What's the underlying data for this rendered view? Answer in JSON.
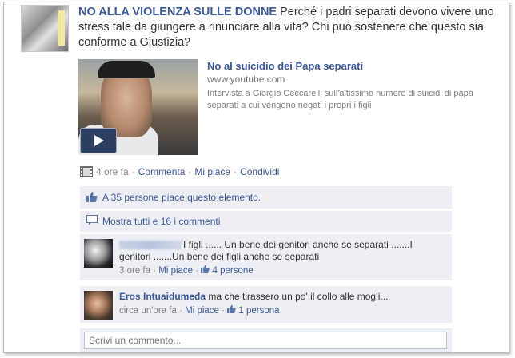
{
  "post": {
    "author": "NO ALLA VIOLENZA SULLE DONNE",
    "text": "Perché i padri separati devono vivere uno stress tale da giungere a rinunciare alla vita? Chi può sostenere che questo sia conforme a Giustizia?"
  },
  "link": {
    "title": "No al suicidio dei Papa separati",
    "url": "www.youtube.com",
    "description": "Intervista a Giorgio Ceccarelli sull'altissimo numero di suicidi di papa separati a cui vengono negati i propri i figli"
  },
  "actions": {
    "time": "4 ore fa",
    "dot": "·",
    "comment": "Commenta",
    "like": "Mi piace",
    "share": "Condividi"
  },
  "likes": {
    "text": "A 35 persone piace questo elemento."
  },
  "show_all": {
    "text": "Mostra tutti e 16 i commenti"
  },
  "comments": [
    {
      "text": "I figli ...... Un bene dei genitori anche se separati .......I genitori .......Un bene dei figli anche se separati",
      "time": "3 ore fa",
      "like": "Mi piace",
      "likes_count": "4 persone"
    },
    {
      "name": "Eros Intuaidumeda",
      "text": "ma che tirassero un po' il collo alle mogli...",
      "time": "circa un'ora fa",
      "like": "Mi piace",
      "likes_count": "1 persona"
    }
  ],
  "write_comment": {
    "placeholder": "Scrivi un commento..."
  },
  "colors": {
    "link": "#3b5998",
    "box_bg": "#edeff4",
    "meta": "#808080"
  }
}
